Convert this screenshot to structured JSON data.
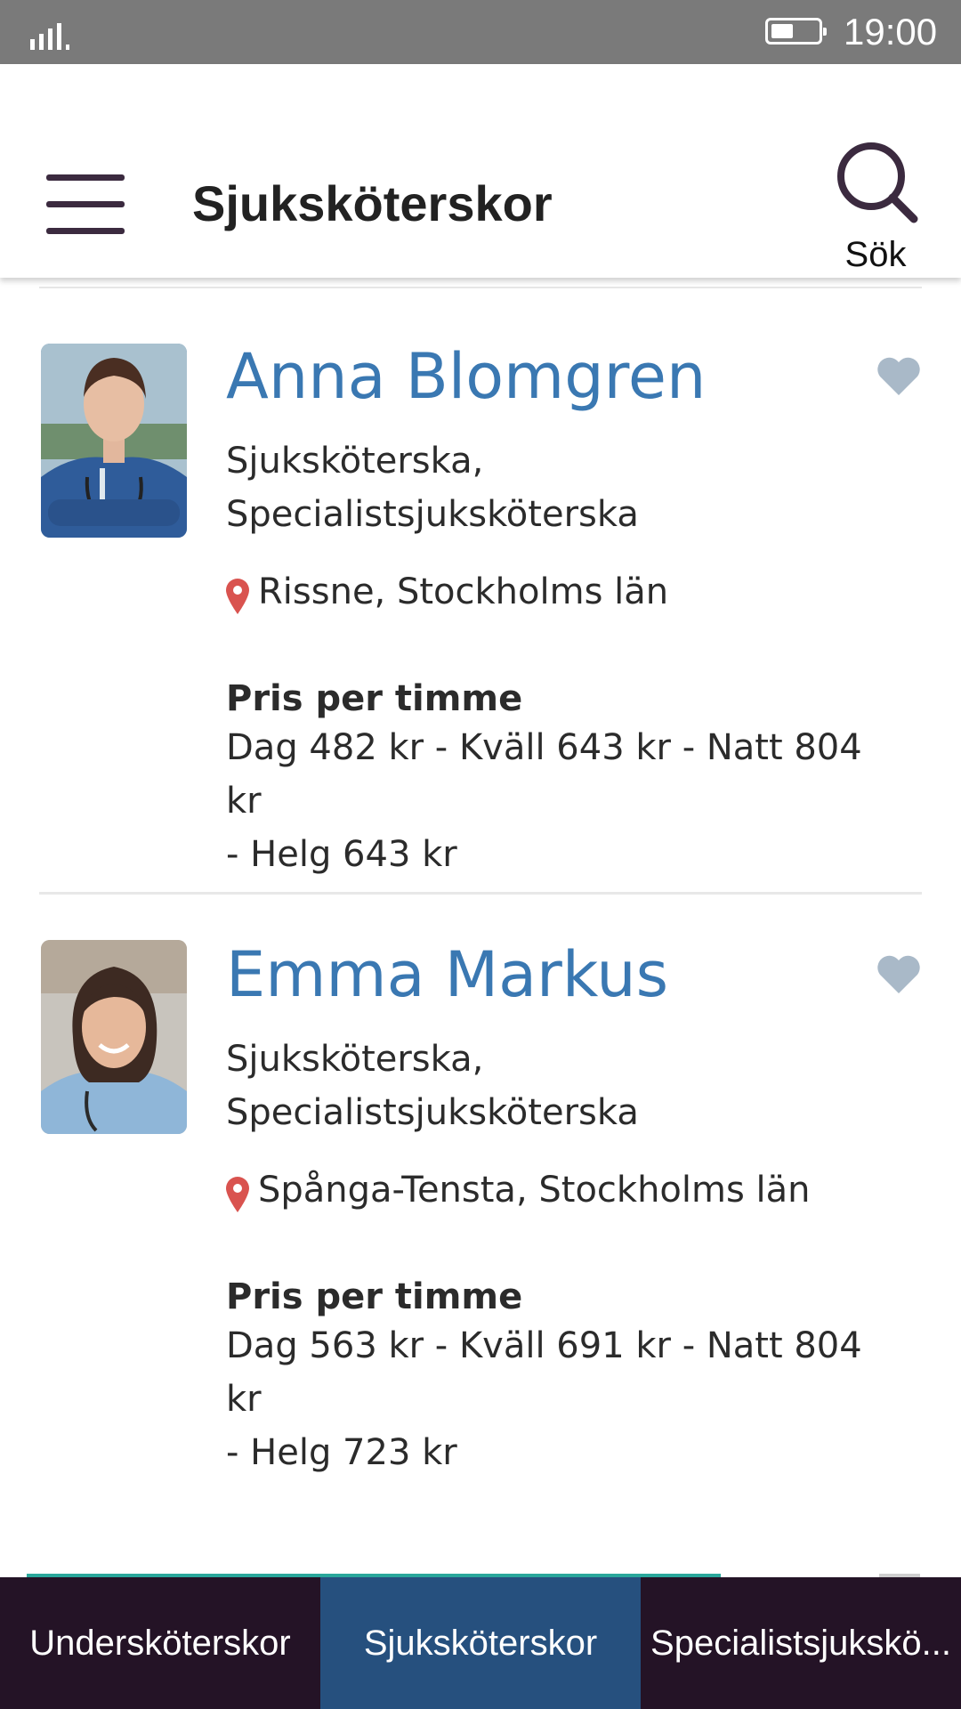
{
  "status_bar": {
    "time": "19:00"
  },
  "header": {
    "title": "Sjuksköterskor",
    "search_label": "Sök"
  },
  "nurses": [
    {
      "name": "Anna Blomgren",
      "role_line1": "Sjuksköterska,",
      "role_line2": "Specialistsjuksköterska",
      "location": "Rissne, Stockholms län",
      "price_title": "Pris per timme",
      "price_line1": "Dag 482 kr - Kväll 643 kr - Natt 804 kr",
      "price_line2": "- Helg 643 kr"
    },
    {
      "name": "Emma Markus",
      "role_line1": "Sjuksköterska,",
      "role_line2": "Specialistsjuksköterska",
      "location": "Spånga-Tensta, Stockholms län",
      "price_title": "Pris per timme",
      "price_line1": "Dag 563 kr - Kväll 691 kr - Natt 804 kr",
      "price_line2": "- Helg 723 kr"
    }
  ],
  "tabs": [
    {
      "label": "Undersköterskor",
      "active": false
    },
    {
      "label": "Sjuksköterskor",
      "active": true
    },
    {
      "label": "Specialistsjukskö..."
    }
  ],
  "colors": {
    "accent_name": "#3a78b2",
    "tab_active": "#26507e",
    "tab_bar": "#241326",
    "heart": "#a9b9c8",
    "pin": "#d9534f"
  }
}
